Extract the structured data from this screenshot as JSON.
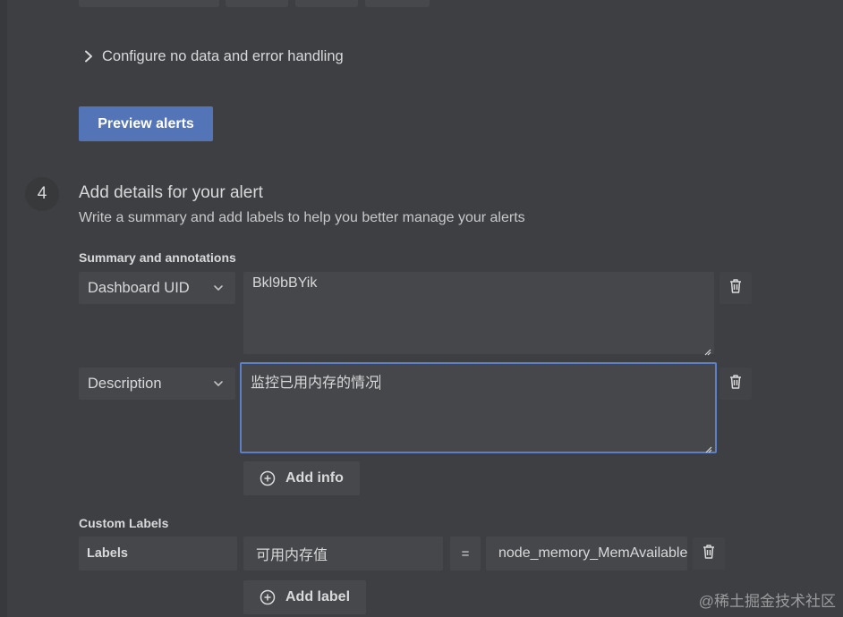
{
  "collapse": {
    "label": "Configure no data and error handling"
  },
  "preview_button": {
    "label": "Preview alerts"
  },
  "step": {
    "number": "4",
    "title": "Add details for your alert",
    "subtitle": "Write a summary and add labels to help you better manage your alerts"
  },
  "annotations": {
    "section_label": "Summary and annotations",
    "rows": [
      {
        "key": "Dashboard UID",
        "value": "Bkl9bBYik"
      },
      {
        "key": "Description",
        "value": "监控已用内存的情况"
      }
    ],
    "add_label": "Add info"
  },
  "custom_labels": {
    "section_label": "Custom Labels",
    "key_label": "Labels",
    "label_key": "可用内存值",
    "operator": "=",
    "label_value": "node_memory_MemAvailable",
    "add_label": "Add label"
  },
  "watermark": "@稀土掘金技术社区",
  "colors": {
    "background": "#3e3f42",
    "field": "#46474a",
    "primary": "#5474b8",
    "focus_border": "#5d7fc7"
  }
}
